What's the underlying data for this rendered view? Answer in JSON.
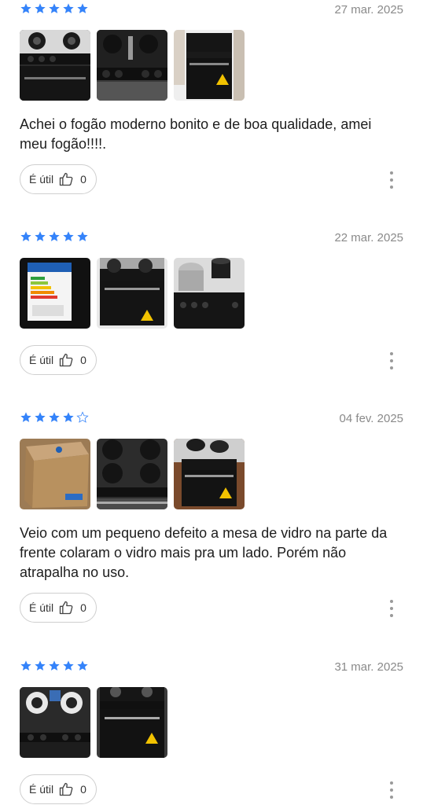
{
  "colors": {
    "star_filled": "#3483fa",
    "star_empty": "#3483fa",
    "date": "#8a8a8a"
  },
  "reviews": [
    {
      "rating": 5,
      "date": "27 mar. 2025",
      "photos": [
        "fogão visto de cima com queimadores",
        "fogão frontal com botões",
        "fogão inteiro com forno"
      ],
      "text": "Achei o fogão moderno bonito e de boa qualidade, amei meu fogão!!!!.",
      "useful_label": "É útil",
      "useful_count": "0"
    },
    {
      "rating": 5,
      "date": "22 mar. 2025",
      "photos": [
        "etiqueta de eficiência energética",
        "fogão com panelas sobre a mesa",
        "fogão com panelas de alumínio"
      ],
      "text": "",
      "useful_label": "É útil",
      "useful_count": "0"
    },
    {
      "rating": 4,
      "date": "04 fev. 2025",
      "photos": [
        "caixa de papelão do fogão",
        "fogão visto de cima",
        "fogão com panelas no piso de madeira"
      ],
      "text": "Veio com um pequeno defeito a mesa de vidro na parte da frente colaram o vidro mais pra um lado. Porém não atrapalha no uso.",
      "useful_label": "É útil",
      "useful_count": "0"
    },
    {
      "rating": 5,
      "date": "31 mar. 2025",
      "photos": [
        "queimadores do fogão vistos de cima",
        "fogão frontal com forno"
      ],
      "text": "",
      "useful_label": "É útil",
      "useful_count": "0"
    }
  ]
}
